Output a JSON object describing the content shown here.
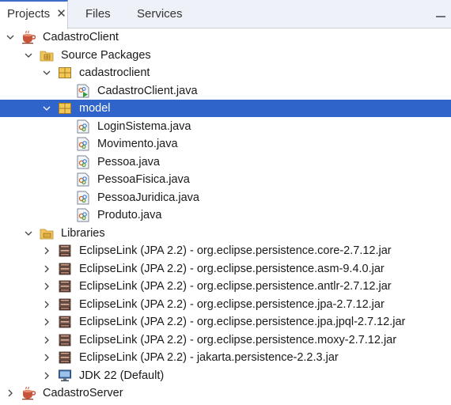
{
  "tabs": [
    {
      "label": "Projects",
      "close": "✕"
    },
    {
      "label": "Files"
    },
    {
      "label": "Services"
    }
  ],
  "tree": [
    {
      "label": "CadastroClient",
      "level": 0,
      "icon": "coffee-project-icon",
      "arrow": "down"
    },
    {
      "label": "Source Packages",
      "level": 1,
      "icon": "folder-package-icon",
      "arrow": "down"
    },
    {
      "label": "cadastroclient",
      "level": 2,
      "icon": "package-icon",
      "arrow": "down"
    },
    {
      "label": "CadastroClient.java",
      "level": 3,
      "icon": "java-main-file-icon",
      "arrow": "none"
    },
    {
      "label": "model",
      "level": 2,
      "icon": "package-icon",
      "arrow": "down",
      "selected": true
    },
    {
      "label": "LoginSistema.java",
      "level": 3,
      "icon": "java-file-icon",
      "arrow": "none"
    },
    {
      "label": "Movimento.java",
      "level": 3,
      "icon": "java-file-icon",
      "arrow": "none"
    },
    {
      "label": "Pessoa.java",
      "level": 3,
      "icon": "java-file-icon",
      "arrow": "none"
    },
    {
      "label": "PessoaFisica.java",
      "level": 3,
      "icon": "java-file-icon",
      "arrow": "none"
    },
    {
      "label": "PessoaJuridica.java",
      "level": 3,
      "icon": "java-file-icon",
      "arrow": "none"
    },
    {
      "label": "Produto.java",
      "level": 3,
      "icon": "java-file-icon",
      "arrow": "none"
    },
    {
      "label": "Libraries",
      "level": 1,
      "icon": "folder-library-icon",
      "arrow": "down"
    },
    {
      "label": "EclipseLink (JPA 2.2) - org.eclipse.persistence.core-2.7.12.jar",
      "level": 2,
      "icon": "jar-icon",
      "arrow": "right"
    },
    {
      "label": "EclipseLink (JPA 2.2) - org.eclipse.persistence.asm-9.4.0.jar",
      "level": 2,
      "icon": "jar-icon",
      "arrow": "right"
    },
    {
      "label": "EclipseLink (JPA 2.2) - org.eclipse.persistence.antlr-2.7.12.jar",
      "level": 2,
      "icon": "jar-icon",
      "arrow": "right"
    },
    {
      "label": "EclipseLink (JPA 2.2) - org.eclipse.persistence.jpa-2.7.12.jar",
      "level": 2,
      "icon": "jar-icon",
      "arrow": "right"
    },
    {
      "label": "EclipseLink (JPA 2.2) - org.eclipse.persistence.jpa.jpql-2.7.12.jar",
      "level": 2,
      "icon": "jar-icon",
      "arrow": "right"
    },
    {
      "label": "EclipseLink (JPA 2.2) - org.eclipse.persistence.moxy-2.7.12.jar",
      "level": 2,
      "icon": "jar-icon",
      "arrow": "right"
    },
    {
      "label": "EclipseLink (JPA 2.2) - jakarta.persistence-2.2.3.jar",
      "level": 2,
      "icon": "jar-icon",
      "arrow": "right"
    },
    {
      "label": "JDK 22 (Default)",
      "level": 2,
      "icon": "jdk-monitor-icon",
      "arrow": "right"
    },
    {
      "label": "CadastroServer",
      "level": 0,
      "icon": "coffee-project-icon",
      "arrow": "right"
    }
  ],
  "colors": {
    "selection": "#2f65ca",
    "folder": "#f2c55c",
    "package": "#e6b43c",
    "tab_bar": "#eef1f7"
  }
}
